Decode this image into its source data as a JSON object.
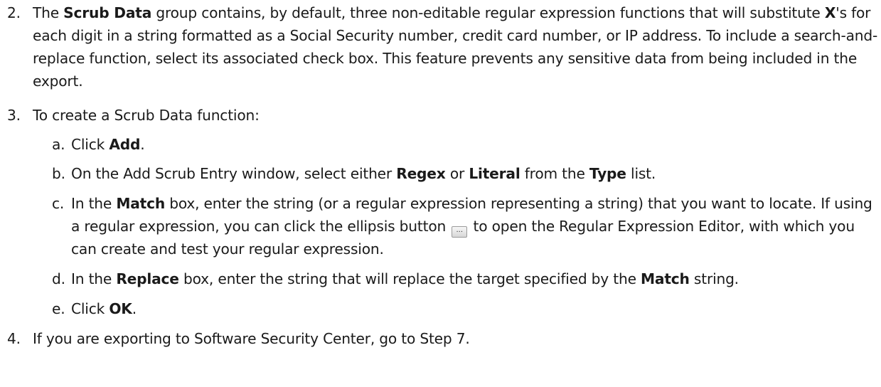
{
  "step2": {
    "number": "2.",
    "t1": "The ",
    "b1": "Scrub Data",
    "t2": " group contains, by default, three non-editable regular expression functions that will substitute ",
    "b2": "X",
    "t3": "'s for each digit in a string formatted as a Social Security number, credit card number, or IP address. To include a search-and-replace function, select its associated check box. This feature prevents any sensitive data from being included in the export."
  },
  "step3": {
    "number": "3.",
    "text": "To create a Scrub Data function:",
    "a": {
      "letter": "a.",
      "t1": "Click ",
      "b1": "Add",
      "t2": "."
    },
    "b": {
      "letter": "b.",
      "t1": "On the Add Scrub Entry window, select either ",
      "b1": "Regex",
      "t2": " or ",
      "b2": "Literal",
      "t3": " from the ",
      "b3": "Type",
      "t4": " list."
    },
    "c": {
      "letter": "c.",
      "t1": "In the ",
      "b1": "Match",
      "t2": " box, enter the string (or a regular expression representing a string) that you want to locate. If using a regular expression, you can click the ellipsis button ",
      "button_glyph": "...",
      "t3": " to open the Regular Expression Editor, with which you can create and test your regular expression."
    },
    "d": {
      "letter": "d.",
      "t1": "In the ",
      "b1": "Replace",
      "t2": " box, enter the string that will replace the target specified by the ",
      "b2": "Match",
      "t3": " string."
    },
    "e": {
      "letter": "e.",
      "t1": "Click ",
      "b1": "OK",
      "t2": "."
    }
  },
  "step4": {
    "number": "4.",
    "text": "If you are exporting to Software Security Center, go to Step 7."
  }
}
